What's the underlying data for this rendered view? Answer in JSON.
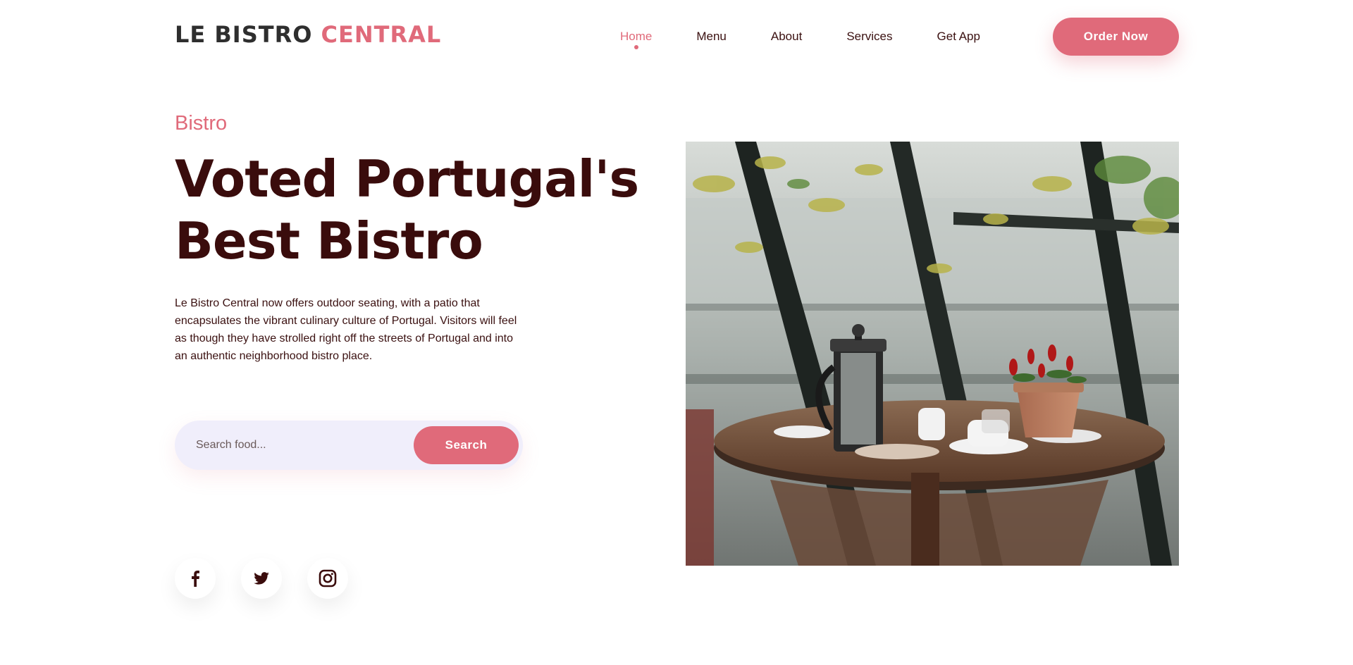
{
  "header": {
    "logo_part1": "LE BISTRO",
    "logo_part2": "CENTRAL",
    "nav": [
      {
        "label": "Home",
        "active": true
      },
      {
        "label": "Menu",
        "active": false
      },
      {
        "label": "About",
        "active": false
      },
      {
        "label": "Services",
        "active": false
      },
      {
        "label": "Get App",
        "active": false
      }
    ],
    "order_button": "Order Now"
  },
  "hero": {
    "eyebrow": "Bistro",
    "headline_line1": "Voted Portugal's",
    "headline_line2": "Best Bistro",
    "description": "Le Bistro Central now offers outdoor seating, with a patio that encapsulates the vibrant culinary culture of Portugal. Visitors will feel as though they have strolled right off the streets of Portugal and into an authentic neighborhood bistro place."
  },
  "search": {
    "placeholder": "Search food...",
    "button": "Search"
  },
  "social": [
    {
      "icon": "facebook-icon"
    },
    {
      "icon": "twitter-icon"
    },
    {
      "icon": "instagram-icon"
    }
  ],
  "colors": {
    "accent": "#e06a7a",
    "headline": "#3a0c0c",
    "logo_dark": "#2e2e2e",
    "search_bg": "#f0eefb"
  }
}
